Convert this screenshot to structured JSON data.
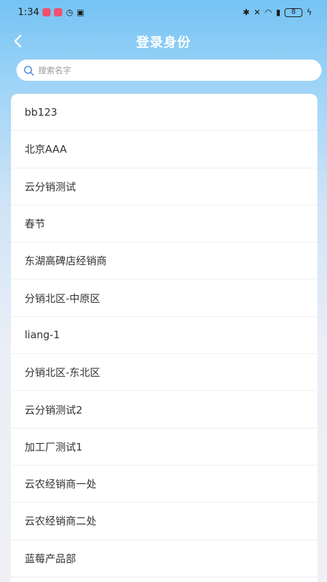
{
  "status_bar": {
    "time": "1:34",
    "battery": "8"
  },
  "header": {
    "title": "登录身份"
  },
  "search": {
    "placeholder": "搜索名字",
    "value": ""
  },
  "identities": [
    "bb123",
    "北京AAA",
    "云分销测试",
    "春节",
    "东湖高碑店经销商",
    "分销北区-中原区",
    "liang-1",
    "分销北区-东北区",
    "云分销测试2",
    "加工厂测试1",
    "云农经销商一处",
    "云农经销商二处",
    "蓝莓产品部"
  ],
  "colors": {
    "accent": "#74c3f3",
    "notification": "#f0506e",
    "search_icon": "#4a8fe0"
  }
}
